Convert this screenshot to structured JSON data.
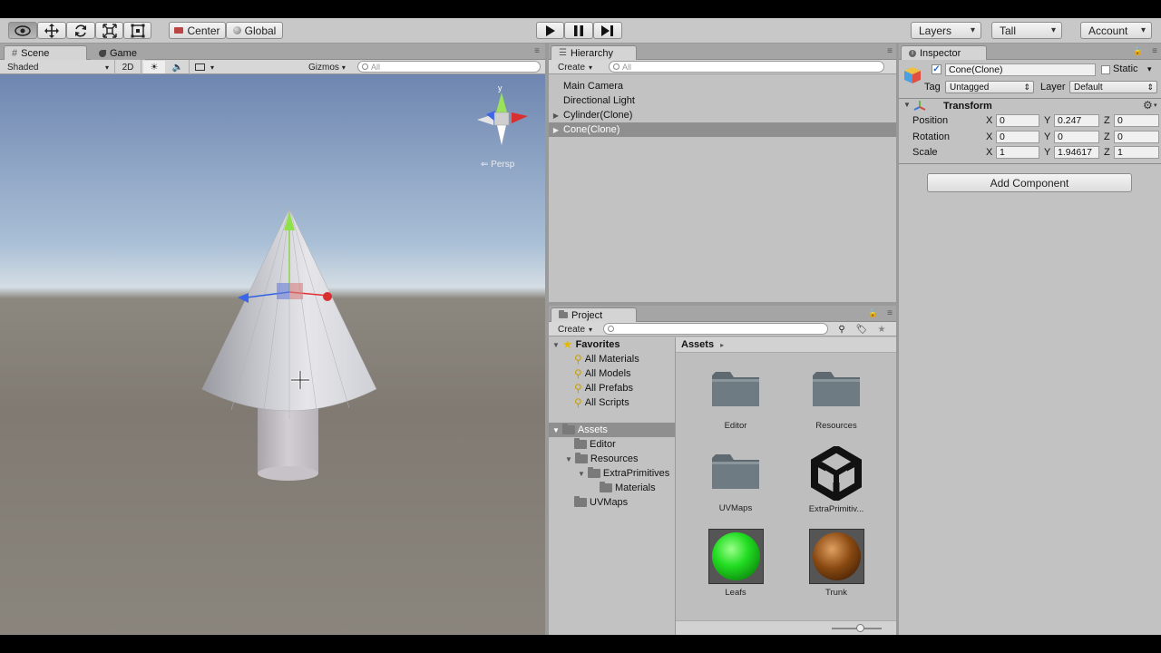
{
  "toolbar": {
    "pivot_label": "Center",
    "space_label": "Global",
    "layers_label": "Layers",
    "layout_label": "Tall",
    "account_label": "Account"
  },
  "scene": {
    "tab_scene": "Scene",
    "tab_game": "Game",
    "draw_mode": "Shaded",
    "mode_2d": "2D",
    "gizmos_label": "Gizmos",
    "search_placeholder": "All",
    "gizmo_y": "y",
    "persp_label": "Persp"
  },
  "hierarchy": {
    "tab": "Hierarchy",
    "create_label": "Create",
    "search_placeholder": "All",
    "items": [
      {
        "label": "Main Camera",
        "has_children": false,
        "selected": false
      },
      {
        "label": "Directional Light",
        "has_children": false,
        "selected": false
      },
      {
        "label": "Cylinder(Clone)",
        "has_children": true,
        "selected": false
      },
      {
        "label": "Cone(Clone)",
        "has_children": true,
        "selected": true
      }
    ]
  },
  "project": {
    "tab": "Project",
    "create_label": "Create",
    "favorites_label": "Favorites",
    "favorites": [
      "All Materials",
      "All Models",
      "All Prefabs",
      "All Scripts"
    ],
    "assets_label": "Assets",
    "tree": [
      "Editor",
      "Resources",
      "ExtraPrimitives",
      "Materials",
      "UVMaps"
    ],
    "breadcrumb": "Assets",
    "assets": [
      {
        "label": "Editor",
        "kind": "folder"
      },
      {
        "label": "Resources",
        "kind": "folder"
      },
      {
        "label": "UVMaps",
        "kind": "folder"
      },
      {
        "label": "ExtraPrimitiv...",
        "kind": "unity-logo"
      },
      {
        "label": "Leafs",
        "kind": "material",
        "color": "#22dd22"
      },
      {
        "label": "Trunk",
        "kind": "material",
        "color": "#8a4a12"
      }
    ]
  },
  "inspector": {
    "tab": "Inspector",
    "object_name": "Cone(Clone)",
    "static_label": "Static",
    "tag_label": "Tag",
    "tag_value": "Untagged",
    "layer_label": "Layer",
    "layer_value": "Default",
    "component_title": "Transform",
    "rows": [
      {
        "label": "Position",
        "x": "0",
        "y": "0.247",
        "z": "0"
      },
      {
        "label": "Rotation",
        "x": "0",
        "y": "0",
        "z": "0"
      },
      {
        "label": "Scale",
        "x": "1",
        "y": "1.94617",
        "z": "1"
      }
    ],
    "axis_x": "X",
    "axis_y": "Y",
    "axis_z": "Z",
    "add_component_label": "Add Component"
  }
}
